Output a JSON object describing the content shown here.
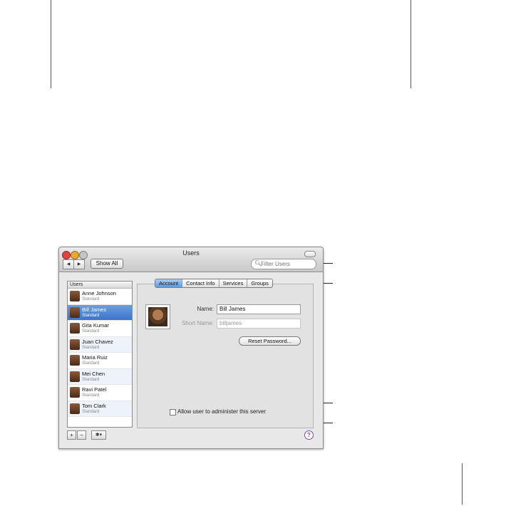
{
  "window": {
    "title": "Users",
    "toolbar": {
      "back": "◀",
      "forward": "▶",
      "show_all": "Show All"
    },
    "search": {
      "placeholder": "Filter Users",
      "icon": "magnifier-icon"
    }
  },
  "users_list": {
    "header": "Users",
    "items": [
      {
        "name": "Anne Johnson",
        "role": "Standard"
      },
      {
        "name": "Bill James",
        "role": "Standard",
        "selected": true
      },
      {
        "name": "Gita Kumar",
        "role": "Standard"
      },
      {
        "name": "Juan Chavez",
        "role": "Standard"
      },
      {
        "name": "Maria Ruiz",
        "role": "Standard"
      },
      {
        "name": "Mei Chen",
        "role": "Standard"
      },
      {
        "name": "Ravi Patel",
        "role": "Standard"
      },
      {
        "name": "Tom Clark",
        "role": "Standard"
      }
    ]
  },
  "tabs": [
    "Account",
    "Contact Info",
    "Services",
    "Groups"
  ],
  "selected_tab": "Account",
  "account": {
    "name_label": "Name:",
    "name_value": "Bill James",
    "short_name_label": "Short Name:",
    "short_name_value": "billjames",
    "reset_password": "Reset Password...",
    "admin_checkbox": "Allow user to administer this server",
    "admin_checked": false
  },
  "bottom_bar": {
    "add": "+",
    "remove": "−",
    "action": "✱▾",
    "help": "?"
  },
  "colors": {
    "selection": "#3d74c9",
    "help": "#7a4bb0"
  }
}
